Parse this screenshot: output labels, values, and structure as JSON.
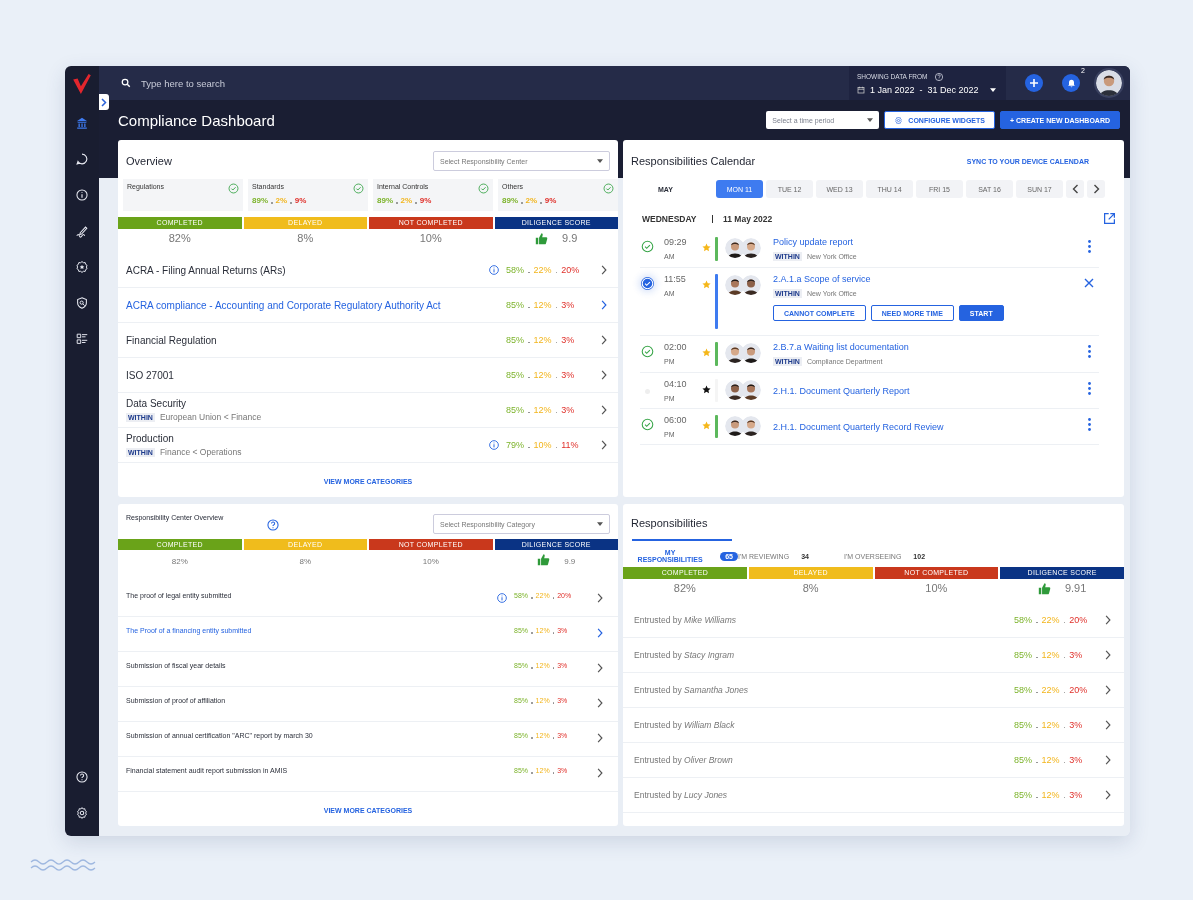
{
  "sidebar": {
    "items": [
      {
        "selected": true
      },
      {
        "selected": false
      },
      {
        "selected": false
      },
      {
        "selected": false
      },
      {
        "selected": false
      },
      {
        "selected": false
      },
      {
        "selected": false
      }
    ]
  },
  "search": {
    "placeholder": "Type here to search"
  },
  "date_range": {
    "label": "SHOWING DATA FROM",
    "value": "1 Jan 2022  -  31 Dec 2022"
  },
  "notifications": {
    "count": "2"
  },
  "page_title": "Compliance Dashboard",
  "time_period": {
    "placeholder": "Select a time period"
  },
  "buttons": [
    {
      "label": "CONFIGURE WIDGETS",
      "kind": "outline"
    },
    {
      "label": "+ CREATE NEW DASHBOARD",
      "kind": "primary"
    }
  ],
  "overview": {
    "title": "Overview",
    "select": {
      "placeholder": "Select Responsibility Center"
    },
    "categories": [
      {
        "name": "Regulations",
        "checked": true
      },
      {
        "name": "Standards",
        "checked": true,
        "completed": "89%",
        "delayed": "2%",
        "not_completed": "9%"
      },
      {
        "name": "Internal Controls",
        "checked": true,
        "completed": "89%",
        "delayed": "2%",
        "not_completed": "9%"
      },
      {
        "name": "Others",
        "checked": true,
        "completed": "89%",
        "delayed": "2%",
        "not_completed": "9%"
      }
    ],
    "summary": [
      {
        "label": "COMPLETED",
        "value": "82%",
        "color": "#6aa319",
        "kind": "percent"
      },
      {
        "label": "DELAYED",
        "value": "8%",
        "color": "#f0bc1c",
        "kind": "percent"
      },
      {
        "label": "NOT COMPLETED",
        "value": "10%",
        "color": "#c9381c",
        "kind": "percent"
      },
      {
        "label": "DILIGENCE SCORE",
        "value": "9.9",
        "color": "#0a3384",
        "kind": "score"
      }
    ],
    "rows": [
      {
        "title": "ACRA - Filing Annual Returns (ARs)",
        "info": true,
        "selected": false,
        "completed": "58%",
        "delayed": "22%",
        "not_completed": "20%"
      },
      {
        "title": "ACRA compliance - Accounting and Corporate Regulatory Authority Act",
        "info": false,
        "selected": true,
        "completed": "85%",
        "delayed": "12%",
        "not_completed": "3%"
      },
      {
        "title": "Financial Regulation",
        "info": false,
        "selected": false,
        "completed": "85%",
        "delayed": "12%",
        "not_completed": "3%"
      },
      {
        "title": "ISO 27001",
        "info": false,
        "selected": false,
        "completed": "85%",
        "delayed": "12%",
        "not_completed": "3%"
      },
      {
        "title": "Data Security",
        "scope": {
          "label": "WITHIN",
          "path": "European Union < Finance"
        },
        "info": false,
        "selected": false,
        "completed": "85%",
        "delayed": "12%",
        "not_completed": "3%"
      },
      {
        "title": "Production",
        "scope": {
          "label": "WITHIN",
          "path": "Finance < Operations"
        },
        "info": true,
        "selected": false,
        "completed": "79%",
        "delayed": "10%",
        "not_completed": "11%"
      }
    ],
    "link": "VIEW MORE CATEGORIES"
  },
  "calendar": {
    "title": "Responsibilities Calendar",
    "sync_link": "SYNC TO YOUR DEVICE CALENDAR",
    "month": "MAY",
    "days": [
      {
        "label": "MON 11",
        "selected": true
      },
      {
        "label": "TUE 12",
        "selected": false
      },
      {
        "label": "WED 13",
        "selected": false
      },
      {
        "label": "THU 14",
        "selected": false
      },
      {
        "label": "FRI 15",
        "selected": false
      },
      {
        "label": "SAT 16",
        "selected": false
      },
      {
        "label": "SUN 17",
        "selected": false
      }
    ],
    "weekday": "WEDNESDAY",
    "date": "11 May 2022",
    "events": [
      {
        "time": "09:29",
        "period": "AM",
        "kind": "done",
        "starred": true,
        "title": "Policy update report",
        "scope": {
          "label": "WITHIN",
          "path": "New York Office"
        },
        "expanded": false
      },
      {
        "time": "11:55",
        "period": "AM",
        "kind": "active",
        "starred": true,
        "title": "2.A.1.a Scope of service",
        "scope": {
          "label": "WITHIN",
          "path": "New York Office"
        },
        "expanded": true,
        "actions": [
          {
            "label": "CANNOT COMPLETE",
            "kind": "outline"
          },
          {
            "label": "NEED MORE TIME",
            "kind": "outline"
          },
          {
            "label": "START",
            "kind": "primary"
          }
        ]
      },
      {
        "time": "02:00",
        "period": "PM",
        "kind": "done",
        "starred": true,
        "title": "2.B.7.a Waiting list documentation",
        "scope": {
          "label": "WITHIN",
          "path": "Compliance Department"
        },
        "expanded": false
      },
      {
        "time": "04:10",
        "period": "PM",
        "kind": "pending",
        "starred": false,
        "title": "2.H.1. Document Quarterly Report",
        "expanded": false
      },
      {
        "time": "06:00",
        "period": "PM",
        "kind": "done",
        "starred": true,
        "title": "2.H.1. Document Quarterly Record Review",
        "expanded": false
      }
    ]
  },
  "center_overview": {
    "title": "Responsibility Center Overview",
    "select": {
      "placeholder": "Select Responsibility Category"
    },
    "summary": [
      {
        "label": "COMPLETED",
        "value": "82%",
        "color": "#6aa319",
        "kind": "percent"
      },
      {
        "label": "DELAYED",
        "value": "8%",
        "color": "#f0bc1c",
        "kind": "percent"
      },
      {
        "label": "NOT COMPLETED",
        "value": "10%",
        "color": "#c9381c",
        "kind": "percent"
      },
      {
        "label": "DILIGENCE SCORE",
        "value": "9.9",
        "color": "#0a3384",
        "kind": "score"
      }
    ],
    "rows": [
      {
        "title": "The proof of legal entity submitted",
        "info": true,
        "selected": false,
        "completed": "58%",
        "delayed": "22%",
        "not_completed": "20%"
      },
      {
        "title": "The Proof of a financing entity submitted",
        "info": false,
        "selected": true,
        "completed": "85%",
        "delayed": "12%",
        "not_completed": "3%"
      },
      {
        "title": "Submission of fiscal year details",
        "info": false,
        "selected": false,
        "completed": "85%",
        "delayed": "12%",
        "not_completed": "3%"
      },
      {
        "title": "Submission of proof of affiliation",
        "info": false,
        "selected": false,
        "completed": "85%",
        "delayed": "12%",
        "not_completed": "3%"
      },
      {
        "title": "Submission of annual certification \"ARC\" report by march 30",
        "info": false,
        "selected": false,
        "completed": "85%",
        "delayed": "12%",
        "not_completed": "3%"
      },
      {
        "title": "Financial statement audit report submission in AMIS",
        "info": false,
        "selected": false,
        "completed": "85%",
        "delayed": "12%",
        "not_completed": "3%"
      }
    ],
    "link": "VIEW MORE CATEGORIES"
  },
  "responsibilities": {
    "title": "Responsibilities",
    "tabs": [
      {
        "label": "MY RESPONSIBILITIES",
        "count": "65",
        "selected": true
      },
      {
        "label": "I'M REVIEWING",
        "count": "34",
        "selected": false
      },
      {
        "label": "I'M OVERSEEING",
        "count": "102",
        "selected": false
      }
    ],
    "summary": [
      {
        "label": "COMPLETED",
        "value": "82%",
        "color": "#6aa319",
        "kind": "percent"
      },
      {
        "label": "DELAYED",
        "value": "8%",
        "color": "#f0bc1c",
        "kind": "percent"
      },
      {
        "label": "NOT COMPLETED",
        "value": "10%",
        "color": "#c9381c",
        "kind": "percent"
      },
      {
        "label": "DILIGENCE SCORE",
        "value": "9.91",
        "color": "#0a3384",
        "kind": "score"
      }
    ],
    "rows": [
      {
        "text": "Entrusted by *Mike Williams*",
        "completed": "58%",
        "delayed": "22%",
        "not_completed": "20%"
      },
      {
        "text": "Entrusted by *Stacy Ingram*",
        "completed": "85%",
        "delayed": "12%",
        "not_completed": "3%"
      },
      {
        "text": "Entrusted by *Samantha Jones*",
        "completed": "58%",
        "delayed": "22%",
        "not_completed": "20%"
      },
      {
        "text": "Entrusted by *William Black*",
        "completed": "85%",
        "delayed": "12%",
        "not_completed": "3%"
      },
      {
        "text": "Entrusted by *Oliver Brown*",
        "completed": "85%",
        "delayed": "12%",
        "not_completed": "3%"
      },
      {
        "text": "Entrusted by *Lucy Jones*",
        "completed": "85%",
        "delayed": "12%",
        "not_completed": "3%"
      }
    ]
  }
}
